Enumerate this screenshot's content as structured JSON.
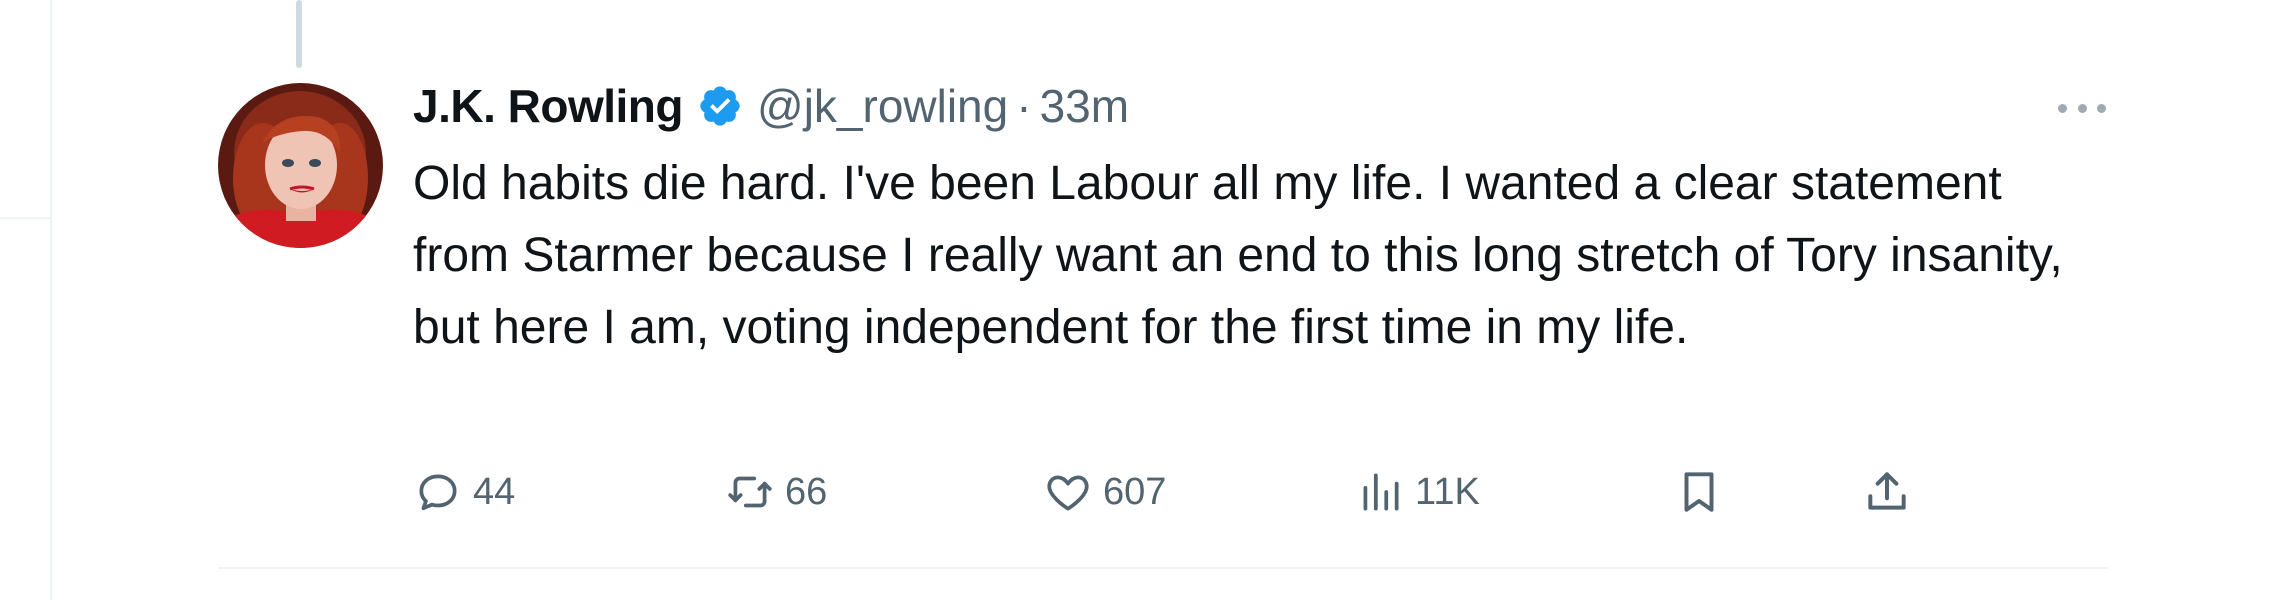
{
  "tweet": {
    "author_name": "J.K. Rowling",
    "verified": true,
    "handle": "@jk_rowling",
    "separator": "·",
    "time": "33m",
    "text": "Old habits die hard. I've been Labour all my life. I wanted a clear statement from Starmer because I really want an end to this long stretch of Tory insanity, but here I am, voting independent for the first time in my life."
  },
  "actions": {
    "replies": "44",
    "reposts": "66",
    "likes": "607",
    "views": "11K"
  },
  "icons": {
    "verified": "verified-badge-icon",
    "more": "more-options-icon",
    "reply": "reply-icon",
    "repost": "repost-icon",
    "like": "heart-icon",
    "views": "views-chart-icon",
    "bookmark": "bookmark-icon",
    "share": "share-icon"
  },
  "colors": {
    "text": "#0f1419",
    "secondary": "#536471",
    "verified_blue": "#1d9bf0",
    "divider": "#eff3f4"
  }
}
